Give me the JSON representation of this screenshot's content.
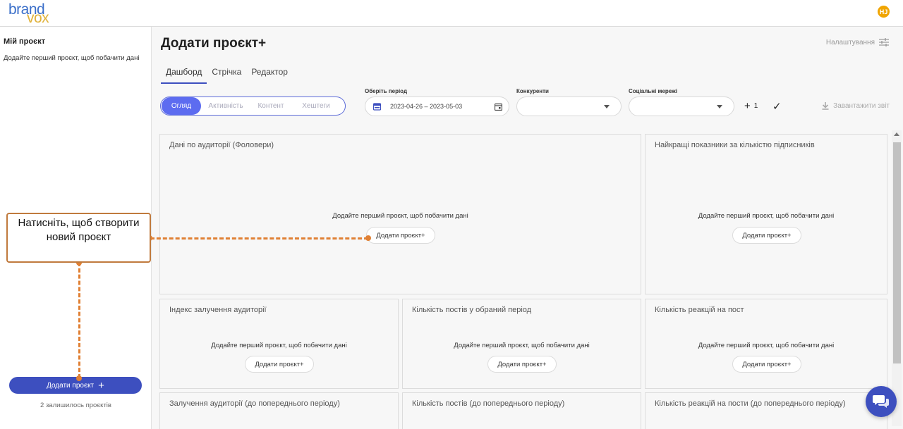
{
  "brand": {
    "logo_top": "brand",
    "logo_bottom": "vox",
    "accent": "#3d4fbf"
  },
  "user": {
    "initials": "HJ",
    "avatar_color": "#f0a500"
  },
  "sidebar": {
    "title": "Мій проєкт",
    "subtitle": "Додайте перший проєкт, щоб побачити дані",
    "add_button": "Додати проєкт",
    "remaining": "2 залишилось проєктів"
  },
  "header": {
    "title": "Додати проєкт+",
    "settings": "Налаштування"
  },
  "tabs": [
    {
      "label": "Дашборд",
      "active": true
    },
    {
      "label": "Стрічка",
      "active": false
    },
    {
      "label": "Редактор",
      "active": false
    }
  ],
  "segments": [
    {
      "label": "Огляд",
      "active": true
    },
    {
      "label": "Активність",
      "active": false
    },
    {
      "label": "Контент",
      "active": false
    },
    {
      "label": "Хештеги",
      "active": false
    }
  ],
  "filters": {
    "period_label": "Оберіть період",
    "period_value": "2023-04-26 – 2023-05-03",
    "competitors_label": "Конкуренти",
    "networks_label": "Соціальні мережі",
    "added_count": "1",
    "download": "Завантажити звіт"
  },
  "cards": [
    {
      "title": "Дані по аудиторії (Фоловери)",
      "empty": "Додайте перший проєкт, щоб побачити дані",
      "button": "Додати проєкт+"
    },
    {
      "title": "Найкращі показники за кількістю підписників",
      "empty": "Додайте перший проєкт, щоб побачити дані",
      "button": "Додати проєкт+"
    },
    {
      "title": "Індекс залучення аудиторії",
      "empty": "Додайте перший проєкт, щоб побачити дані",
      "button": "Додати проєкт+"
    },
    {
      "title": "Кількість постів у обраний період",
      "empty": "Додайте перший проєкт, щоб побачити дані",
      "button": "Додати проєкт+"
    },
    {
      "title": "Кількість реакцій на пост",
      "empty": "Додайте перший проєкт, щоб побачити дані",
      "button": "Додати проєкт+"
    },
    {
      "title": "Залучення аудиторії (до попереднього періоду)"
    },
    {
      "title": "Кількість постів (до попереднього періоду)"
    },
    {
      "title": "Кількість реакцій на пости (до попереднього періоду)"
    }
  ],
  "callout": {
    "text": "Натисніть, щоб створити новий проєкт"
  }
}
